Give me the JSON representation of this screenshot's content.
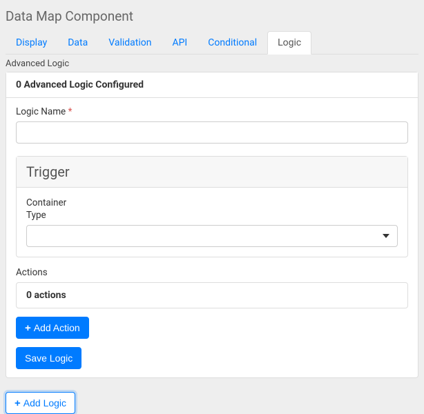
{
  "header": {
    "title": "Data Map Component"
  },
  "tabs": [
    {
      "label": "Display",
      "active": false
    },
    {
      "label": "Data",
      "active": false
    },
    {
      "label": "Validation",
      "active": false
    },
    {
      "label": "API",
      "active": false
    },
    {
      "label": "Conditional",
      "active": false
    },
    {
      "label": "Logic",
      "active": true
    }
  ],
  "section_label": "Advanced Logic",
  "logic_card": {
    "configured_header": "0 Advanced Logic Configured",
    "name_label": "Logic Name",
    "name_required": "*",
    "name_value": "",
    "trigger": {
      "title": "Trigger",
      "container_label": "Container",
      "type_label": "Type",
      "type_value": ""
    },
    "actions": {
      "label": "Actions",
      "summary": "0 actions",
      "add_button": "Add Action"
    },
    "save_button": "Save Logic"
  },
  "add_logic_button": "Add Logic",
  "icons": {
    "plus": "+"
  }
}
